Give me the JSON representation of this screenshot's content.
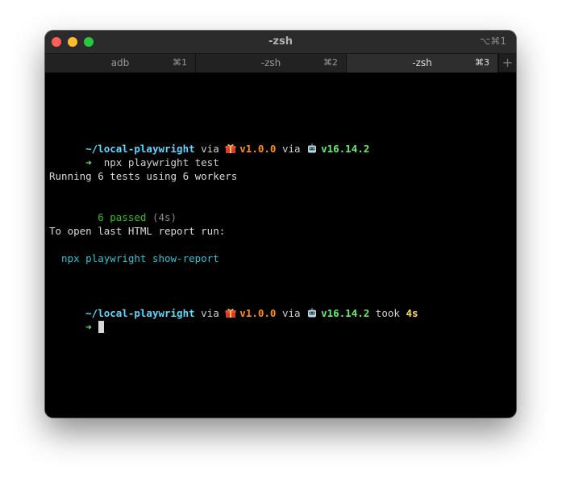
{
  "window": {
    "title": "-zsh",
    "title_shortcut": "⌥⌘1"
  },
  "tabs": [
    {
      "label": "adb",
      "shortcut": "⌘1",
      "active": false
    },
    {
      "label": "-zsh",
      "shortcut": "⌘2",
      "active": false
    },
    {
      "label": "-zsh",
      "shortcut": "⌘3",
      "active": true
    }
  ],
  "new_tab_label": "+",
  "terminal": {
    "prompt1": {
      "path": "~/local-playwright",
      "via1": " via ",
      "pkg_icon": "gift-icon",
      "pkg_version": "v1.0.0",
      "via2": " via ",
      "node_icon": "robot-icon",
      "node_version": "v16.14.2"
    },
    "command1": {
      "arrow": "➜",
      "text": "  npx playwright test"
    },
    "running": "Running 6 tests using 6 workers",
    "passed": "  6 passed",
    "passed_time": " (4s)",
    "open_report": "To open last HTML report run:",
    "report_command": "  npx playwright show-report",
    "prompt2": {
      "path": "~/local-playwright",
      "via1": " via ",
      "pkg_icon": "gift-icon",
      "pkg_version": "v1.0.0",
      "via2": " via ",
      "node_icon": "robot-icon",
      "node_version": "v16.14.2",
      "took": " took ",
      "duration": "4s"
    },
    "command2": {
      "arrow": "➜"
    }
  },
  "colors": {
    "path": "#5fd7ff",
    "pkg_version": "#ff8c1a",
    "node_version": "#5ff06f",
    "passed": "#2ec11f",
    "report_command": "#2bc5d2",
    "duration": "#ffe04a"
  }
}
